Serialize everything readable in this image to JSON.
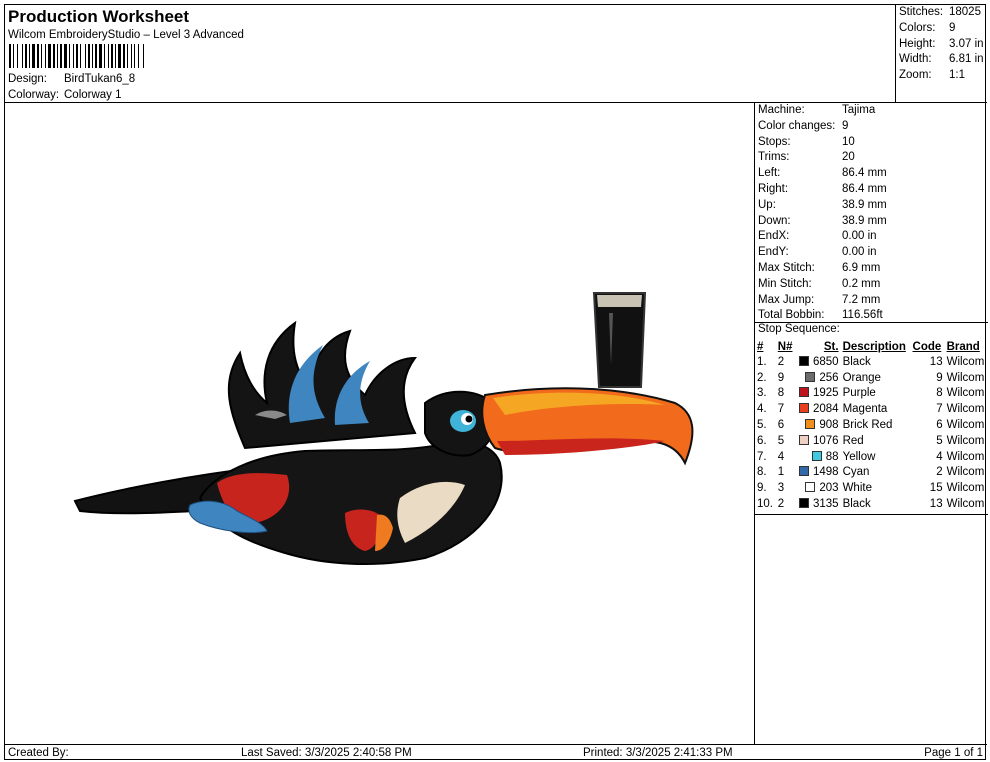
{
  "header": {
    "title": "Production Worksheet",
    "software": "Wilcom EmbroideryStudio – Level 3 Advanced",
    "design_label": "Design:",
    "design_value": "BirdTukan6_8",
    "colorway_label": "Colorway:",
    "colorway_value": "Colorway 1"
  },
  "summary": {
    "stitches_label": "Stitches:",
    "stitches_value": "18025",
    "colors_label": "Colors:",
    "colors_value": "9",
    "height_label": "Height:",
    "height_value": "3.07 in",
    "width_label": "Width:",
    "width_value": "6.81 in",
    "zoom_label": "Zoom:",
    "zoom_value": "1:1"
  },
  "specs": [
    {
      "label": "Machine:",
      "value": "Tajima"
    },
    {
      "label": "Color changes:",
      "value": "9"
    },
    {
      "label": "Stops:",
      "value": "10"
    },
    {
      "label": "Trims:",
      "value": "20"
    },
    {
      "label": "Left:",
      "value": "86.4 mm"
    },
    {
      "label": "Right:",
      "value": "86.4 mm"
    },
    {
      "label": "Up:",
      "value": "38.9 mm"
    },
    {
      "label": "Down:",
      "value": "38.9 mm"
    },
    {
      "label": "EndX:",
      "value": "0.00 in"
    },
    {
      "label": "EndY:",
      "value": "0.00 in"
    },
    {
      "label": "Max Stitch:",
      "value": "6.9 mm"
    },
    {
      "label": "Min Stitch:",
      "value": "0.2 mm"
    },
    {
      "label": "Max Jump:",
      "value": "7.2 mm"
    },
    {
      "label": "Total Bobbin:",
      "value": "116.56ft"
    }
  ],
  "stop_sequence": {
    "title": "Stop Sequence:",
    "headers": {
      "idx": "#",
      "n": "N#",
      "st": "St.",
      "desc": "Description",
      "code": "Code",
      "brand": "Brand"
    },
    "rows": [
      {
        "idx": "1.",
        "n": "2",
        "color": "#000000",
        "st": "6850",
        "desc": "Black",
        "code": "13",
        "brand": "Wilcom"
      },
      {
        "idx": "2.",
        "n": "9",
        "color": "#6b6b6b",
        "st": "256",
        "desc": "Orange",
        "code": "9",
        "brand": "Wilcom"
      },
      {
        "idx": "3.",
        "n": "8",
        "color": "#c0141c",
        "st": "1925",
        "desc": "Purple",
        "code": "8",
        "brand": "Wilcom"
      },
      {
        "idx": "4.",
        "n": "7",
        "color": "#e8401c",
        "st": "2084",
        "desc": "Magenta",
        "code": "7",
        "brand": "Wilcom"
      },
      {
        "idx": "5.",
        "n": "6",
        "color": "#f0901c",
        "st": "908",
        "desc": "Brick Red",
        "code": "6",
        "brand": "Wilcom"
      },
      {
        "idx": "6.",
        "n": "5",
        "color": "#f0d0c0",
        "st": "1076",
        "desc": "Red",
        "code": "5",
        "brand": "Wilcom"
      },
      {
        "idx": "7.",
        "n": "4",
        "color": "#40c8e0",
        "st": "88",
        "desc": "Yellow",
        "code": "4",
        "brand": "Wilcom"
      },
      {
        "idx": "8.",
        "n": "1",
        "color": "#3068a8",
        "st": "1498",
        "desc": "Cyan",
        "code": "2",
        "brand": "Wilcom"
      },
      {
        "idx": "9.",
        "n": "3",
        "color": "#ffffff",
        "st": "203",
        "desc": "White",
        "code": "15",
        "brand": "Wilcom"
      },
      {
        "idx": "10.",
        "n": "2",
        "color": "#000000",
        "st": "3135",
        "desc": "Black",
        "code": "13",
        "brand": "Wilcom"
      }
    ]
  },
  "footer": {
    "created_by": "Created By:",
    "last_saved": "Last Saved: 3/3/2025 2:40:58 PM",
    "printed": "Printed: 3/3/2025 2:41:33 PM",
    "page": "Page 1 of 1"
  }
}
